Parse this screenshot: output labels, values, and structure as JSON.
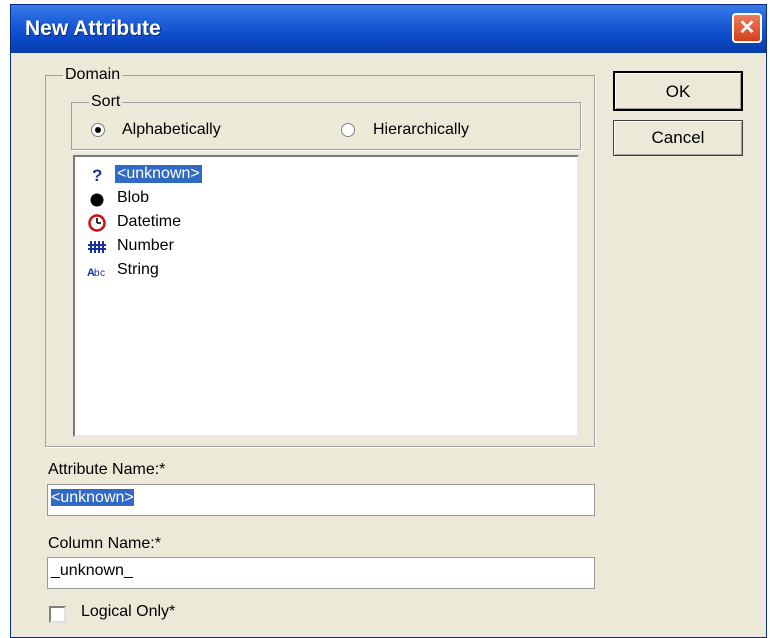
{
  "window": {
    "title": "New Attribute",
    "close_symbol": "✕"
  },
  "domain": {
    "group_label": "Domain",
    "sort": {
      "group_label": "Sort",
      "options": [
        {
          "label": "Alphabetically",
          "selected": true
        },
        {
          "label": "Hierarchically",
          "selected": false
        }
      ]
    },
    "items": [
      {
        "label": "<unknown>",
        "icon": "question-mark-icon",
        "selected": true
      },
      {
        "label": "Blob",
        "icon": "black-dot-icon",
        "selected": false
      },
      {
        "label": "Datetime",
        "icon": "clock-icon",
        "selected": false
      },
      {
        "label": "Number",
        "icon": "number-hash-icon",
        "selected": false
      },
      {
        "label": "String",
        "icon": "string-abc-icon",
        "selected": false
      }
    ]
  },
  "buttons": {
    "ok": "OK",
    "cancel": "Cancel"
  },
  "attribute_name": {
    "label": "Attribute Name:*",
    "value": "<unknown>"
  },
  "column_name": {
    "label": "Column Name:*",
    "value": "_unknown_"
  },
  "logical_only": {
    "label": "Logical Only*",
    "checked": false
  },
  "colors": {
    "title_bar": "#0b49c8",
    "selection": "#316ac5",
    "dialog_bg": "#ece9d8",
    "close_button": "#d2401a"
  }
}
